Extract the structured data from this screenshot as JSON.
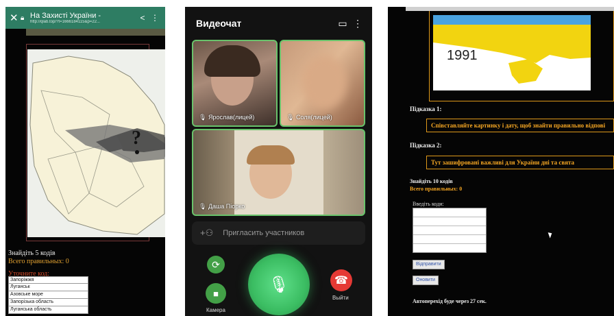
{
  "panel1": {
    "title": "На Захисті України -",
    "url": "http://qlab.top/?t=1666184115&p=22...",
    "status_find": "Знайдіть 5 кодів",
    "status_correct": "Всего правильных: 0",
    "clarify_label": "Уточните код:",
    "options": [
      "Запоріжжя",
      "Луганськ",
      "Азовське море",
      "Запорізька область",
      "Луганська область"
    ]
  },
  "panel2": {
    "title": "Видеочат",
    "participants": [
      "Ярослав(лицей)",
      "Соля(лицей)",
      "Даша Піорко"
    ],
    "invite": "Пригласить участников",
    "camera_label": "Камера",
    "exit_label": "Выйти"
  },
  "panel3": {
    "year": "1991",
    "hint1_title": "Підказка 1:",
    "hint1_text": "Співставляйте картинку і дату, щоб знайти правильно відпові",
    "hint2_title": "Підказка 2:",
    "hint2_text": "Тут зашифровані важливі для України дні та свята",
    "find": "Знайдіть 10 кодів",
    "correct": "Всего правильных: 0",
    "enter_codes": "Введіть коди:",
    "send_button": "Відправити",
    "refresh_button": "Оновити",
    "auto_transition": "Автоперехід буде через 27 сек."
  },
  "colors": {
    "browser_bar": "#2e7d63",
    "tile_border": "#69c36b",
    "mic_green": "#3bbd62",
    "end_red": "#e53935",
    "hint_orange": "#f5a623",
    "map_yellow": "#f2d410"
  }
}
